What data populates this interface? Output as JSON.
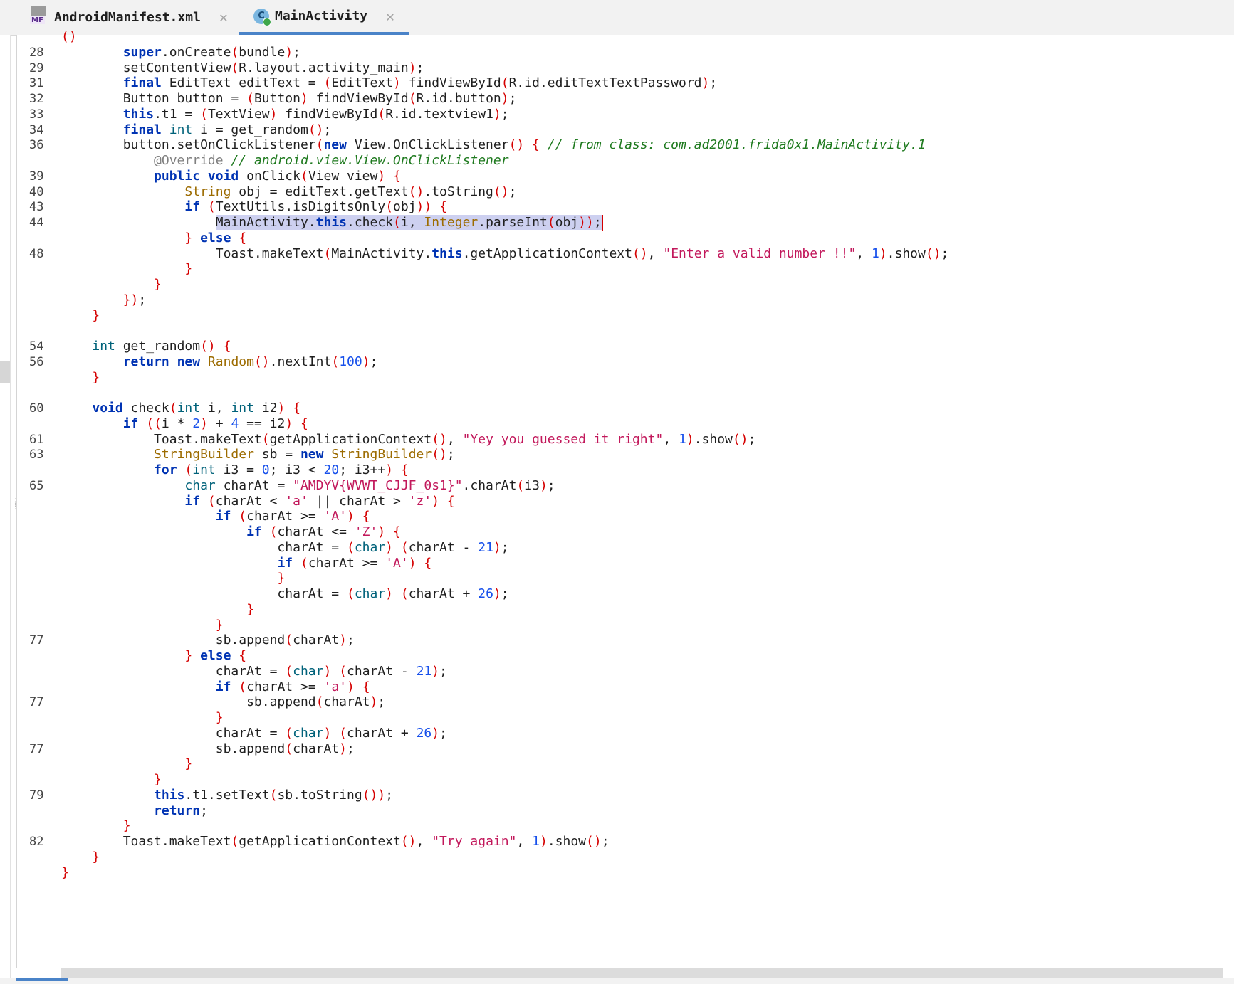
{
  "tabs": [
    {
      "label": "AndroidManifest.xml",
      "icon": "manifest-file-icon",
      "icon_text": "MF",
      "close": "✕"
    },
    {
      "label": "MainActivity",
      "icon": "java-class-icon",
      "icon_text": "C",
      "close": "✕"
    }
  ],
  "editor": {
    "lines": [
      {
        "ln": "",
        "html": "<span class=\"br\">(</span><span class=\"br\">)</span>"
      },
      {
        "ln": "28",
        "html": "        <span class=\"kw\">super</span>.onCreate<span class=\"br\">(</span>bundle<span class=\"br\">)</span>;"
      },
      {
        "ln": "29",
        "html": "        setContentView<span class=\"br\">(</span>R.layout.activity_main<span class=\"br\">)</span>;"
      },
      {
        "ln": "31",
        "html": "        <span class=\"kw\">final</span> EditText editText = <span class=\"br\">(</span>EditText<span class=\"br\">)</span> findViewById<span class=\"br\">(</span>R.id.editTextTextPassword<span class=\"br\">)</span>;"
      },
      {
        "ln": "32",
        "html": "        Button button = <span class=\"br\">(</span>Button<span class=\"br\">)</span> findViewById<span class=\"br\">(</span>R.id.button<span class=\"br\">)</span>;"
      },
      {
        "ln": "33",
        "html": "        <span class=\"kw\">this</span>.t1 = <span class=\"br\">(</span>TextView<span class=\"br\">)</span> findViewById<span class=\"br\">(</span>R.id.textview1<span class=\"br\">)</span>;"
      },
      {
        "ln": "34",
        "html": "        <span class=\"kw\">final</span> <span class=\"kt\">int</span> i = get_random<span class=\"br\">()</span>;"
      },
      {
        "ln": "36",
        "html": "        button.setOnClickListener<span class=\"br\">(</span><span class=\"kw\">new</span> View.OnClickListener<span class=\"br\">()</span> <span class=\"br\">{</span> <span class=\"cm\">// from class: com.ad2001.frida0x1.MainActivity.1</span>"
      },
      {
        "ln": "",
        "html": "            <span class=\"an\">@Override</span> <span class=\"cm\">// android.view.View.OnClickListener</span>"
      },
      {
        "ln": "39",
        "html": "            <span class=\"kw\">public</span> <span class=\"kw\">void</span> onClick<span class=\"br\">(</span>View view<span class=\"br\">)</span> <span class=\"br\">{</span>"
      },
      {
        "ln": "40",
        "html": "                <span class=\"ty\">String</span> obj = editText.getText<span class=\"br\">()</span>.toString<span class=\"br\">()</span>;"
      },
      {
        "ln": "43",
        "html": "                <span class=\"kw\">if</span> <span class=\"br\">(</span>TextUtils.isDigitsOnly<span class=\"br\">(</span>obj<span class=\"br\">))</span> <span class=\"br\">{</span>"
      },
      {
        "ln": "44",
        "html": "                    <span class=\"hl\">MainActivity.<span class=\"kw\">this</span>.check<span class=\"br\">(</span>i, <span class=\"ty\">Integer</span>.parseInt<span class=\"br\">(</span>obj<span class=\"br\">))</span>;</span><span class=\"caret\"></span>"
      },
      {
        "ln": "",
        "html": "                <span class=\"br\">}</span> <span class=\"kw\">else</span> <span class=\"br\">{</span>"
      },
      {
        "ln": "48",
        "html": "                    Toast.makeText<span class=\"br\">(</span>MainActivity.<span class=\"kw\">this</span>.getApplicationContext<span class=\"br\">()</span>, <span class=\"str\">\"Enter a valid number !!\"</span>, <span class=\"num\">1</span><span class=\"br\">)</span>.show<span class=\"br\">()</span>;"
      },
      {
        "ln": "",
        "html": "                <span class=\"br\">}</span>"
      },
      {
        "ln": "",
        "html": "            <span class=\"br\">}</span>"
      },
      {
        "ln": "",
        "html": "        <span class=\"br\">})</span>;"
      },
      {
        "ln": "",
        "html": "    <span class=\"br\">}</span>"
      },
      {
        "ln": "",
        "html": ""
      },
      {
        "ln": "54",
        "html": "    <span class=\"kt\">int</span> get_random<span class=\"br\">()</span> <span class=\"br\">{</span>"
      },
      {
        "ln": "56",
        "html": "        <span class=\"kw\">return</span> <span class=\"kw\">new</span> <span class=\"ty\">Random</span><span class=\"br\">()</span>.nextInt<span class=\"br\">(</span><span class=\"num\">100</span><span class=\"br\">)</span>;"
      },
      {
        "ln": "",
        "html": "    <span class=\"br\">}</span>"
      },
      {
        "ln": "",
        "html": ""
      },
      {
        "ln": "60",
        "html": "    <span class=\"kw\">void</span> check<span class=\"br\">(</span><span class=\"kt\">int</span> i, <span class=\"kt\">int</span> i2<span class=\"br\">)</span> <span class=\"br\">{</span>"
      },
      {
        "ln": "",
        "html": "        <span class=\"kw\">if</span> <span class=\"br\">((</span>i * <span class=\"num\">2</span><span class=\"br\">)</span> + <span class=\"num\">4</span> == i2<span class=\"br\">)</span> <span class=\"br\">{</span>"
      },
      {
        "ln": "61",
        "html": "            Toast.makeText<span class=\"br\">(</span>getApplicationContext<span class=\"br\">()</span>, <span class=\"str\">\"Yey you guessed it right\"</span>, <span class=\"num\">1</span><span class=\"br\">)</span>.show<span class=\"br\">()</span>;"
      },
      {
        "ln": "63",
        "html": "            <span class=\"ty\">StringBuilder</span> sb = <span class=\"kw\">new</span> <span class=\"ty\">StringBuilder</span><span class=\"br\">()</span>;"
      },
      {
        "ln": "",
        "html": "            <span class=\"kw\">for</span> <span class=\"br\">(</span><span class=\"kt\">int</span> i3 = <span class=\"num\">0</span>; i3 &lt; <span class=\"num\">20</span>; i3++<span class=\"br\">)</span> <span class=\"br\">{</span>"
      },
      {
        "ln": "65",
        "html": "                <span class=\"kt\">char</span> charAt = <span class=\"str\">\"AMDYV{WVWT_CJJF_0s1}\"</span>.charAt<span class=\"br\">(</span>i3<span class=\"br\">)</span>;"
      },
      {
        "ln": "",
        "html": "                <span class=\"kw\">if</span> <span class=\"br\">(</span>charAt &lt; <span class=\"str\">'a'</span> || charAt &gt; <span class=\"str\">'z'</span><span class=\"br\">)</span> <span class=\"br\">{</span>"
      },
      {
        "ln": "",
        "html": "                    <span class=\"kw\">if</span> <span class=\"br\">(</span>charAt &gt;= <span class=\"str\">'A'</span><span class=\"br\">)</span> <span class=\"br\">{</span>"
      },
      {
        "ln": "",
        "html": "                        <span class=\"kw\">if</span> <span class=\"br\">(</span>charAt &lt;= <span class=\"str\">'Z'</span><span class=\"br\">)</span> <span class=\"br\">{</span>"
      },
      {
        "ln": "",
        "html": "                            charAt = <span class=\"br\">(</span><span class=\"kt\">char</span><span class=\"br\">)</span> <span class=\"br\">(</span>charAt - <span class=\"num\">21</span><span class=\"br\">)</span>;"
      },
      {
        "ln": "",
        "html": "                            <span class=\"kw\">if</span> <span class=\"br\">(</span>charAt &gt;= <span class=\"str\">'A'</span><span class=\"br\">)</span> <span class=\"br\">{</span>"
      },
      {
        "ln": "",
        "html": "                            <span class=\"br\">}</span>"
      },
      {
        "ln": "",
        "html": "                            charAt = <span class=\"br\">(</span><span class=\"kt\">char</span><span class=\"br\">)</span> <span class=\"br\">(</span>charAt + <span class=\"num\">26</span><span class=\"br\">)</span>;"
      },
      {
        "ln": "",
        "html": "                        <span class=\"br\">}</span>"
      },
      {
        "ln": "",
        "html": "                    <span class=\"br\">}</span>"
      },
      {
        "ln": "77",
        "html": "                    sb.append<span class=\"br\">(</span>charAt<span class=\"br\">)</span>;"
      },
      {
        "ln": "",
        "html": "                <span class=\"br\">}</span> <span class=\"kw\">else</span> <span class=\"br\">{</span>"
      },
      {
        "ln": "",
        "html": "                    charAt = <span class=\"br\">(</span><span class=\"kt\">char</span><span class=\"br\">)</span> <span class=\"br\">(</span>charAt - <span class=\"num\">21</span><span class=\"br\">)</span>;"
      },
      {
        "ln": "",
        "html": "                    <span class=\"kw\">if</span> <span class=\"br\">(</span>charAt &gt;= <span class=\"str\">'a'</span><span class=\"br\">)</span> <span class=\"br\">{</span>"
      },
      {
        "ln": "77",
        "html": "                        sb.append<span class=\"br\">(</span>charAt<span class=\"br\">)</span>;"
      },
      {
        "ln": "",
        "html": "                    <span class=\"br\">}</span>"
      },
      {
        "ln": "",
        "html": "                    charAt = <span class=\"br\">(</span><span class=\"kt\">char</span><span class=\"br\">)</span> <span class=\"br\">(</span>charAt + <span class=\"num\">26</span><span class=\"br\">)</span>;"
      },
      {
        "ln": "77",
        "html": "                    sb.append<span class=\"br\">(</span>charAt<span class=\"br\">)</span>;"
      },
      {
        "ln": "",
        "html": "                <span class=\"br\">}</span>"
      },
      {
        "ln": "",
        "html": "            <span class=\"br\">}</span>"
      },
      {
        "ln": "79",
        "html": "            <span class=\"kw\">this</span>.t1.setText<span class=\"br\">(</span>sb.toString<span class=\"br\">())</span>;"
      },
      {
        "ln": "",
        "html": "            <span class=\"kw\">return</span>;"
      },
      {
        "ln": "",
        "html": "        <span class=\"br\">}</span>"
      },
      {
        "ln": "82",
        "html": "        Toast.makeText<span class=\"br\">(</span>getApplicationContext<span class=\"br\">()</span>, <span class=\"str\">\"Try again\"</span>, <span class=\"num\">1</span><span class=\"br\">)</span>.show<span class=\"br\">()</span>;"
      },
      {
        "ln": "",
        "html": "    <span class=\"br\">}</span>"
      },
      {
        "ln": "",
        "html": "<span class=\"br\">}</span>"
      }
    ]
  },
  "colors": {
    "keyword": "#0033b3",
    "type": "#9c6b00",
    "string": "#c2185b",
    "number": "#1750eb",
    "comment": "#1f7a1f",
    "brace": "#d50000",
    "selection": "#cdd0f0",
    "active_tab_underline": "#4a83c8"
  }
}
